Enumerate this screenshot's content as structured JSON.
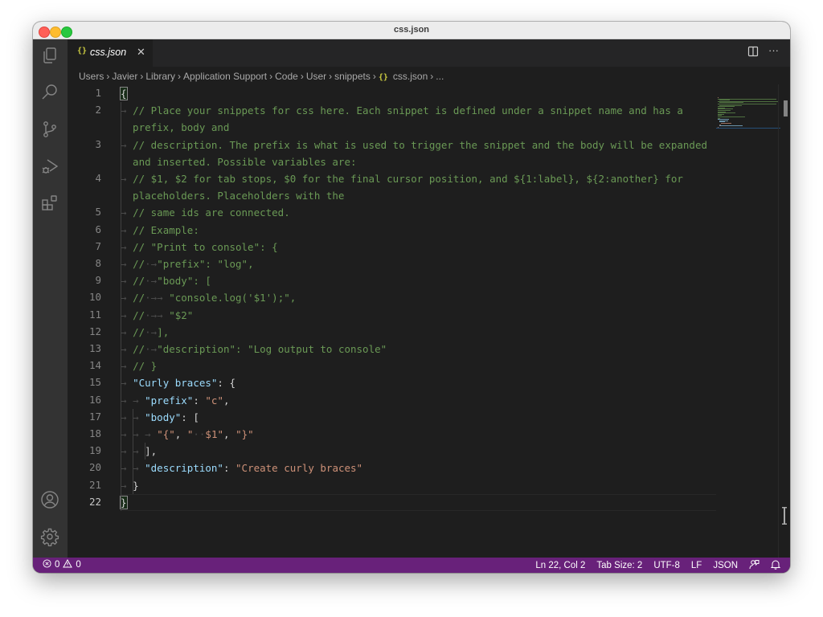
{
  "window": {
    "title": "css.json"
  },
  "activity_bar": [
    {
      "name": "explorer-icon"
    },
    {
      "name": "search-icon"
    },
    {
      "name": "source-control-icon"
    },
    {
      "name": "run-debug-icon"
    },
    {
      "name": "extensions-icon"
    }
  ],
  "activity_bar_bottom": [
    {
      "name": "accounts-icon"
    },
    {
      "name": "manage-gear-icon"
    }
  ],
  "tab": {
    "icon": "{}",
    "label": "css.json",
    "close": "✕"
  },
  "tab_actions": {
    "split": "split-editor-icon",
    "more": "···"
  },
  "breadcrumb": {
    "items": [
      "Users",
      "Javier",
      "Library",
      "Application Support",
      "Code",
      "User",
      "snippets"
    ],
    "file_icon": "{}",
    "file": "css.json",
    "trail": "..."
  },
  "editor": {
    "active_line": 22,
    "lines": [
      {
        "n": "1",
        "tokens": [
          {
            "t": "{",
            "c": "c-punc"
          }
        ]
      },
      {
        "n": "2",
        "tokens": [
          {
            "t": "// Place your snippets for css here. Each snippet is defined under a snippet name and has a",
            "c": "c-comment"
          }
        ],
        "wrap": "prefix, body and"
      },
      {
        "n": "3",
        "tokens": [
          {
            "t": "// description. The prefix is what is used to trigger the snippet and the body will be expanded",
            "c": "c-comment"
          }
        ],
        "wrap": "and inserted. Possible variables are:"
      },
      {
        "n": "4",
        "tokens": [
          {
            "t": "// $1, $2 for tab stops, $0 for the final cursor position, and ${1:label}, ${2:another} for",
            "c": "c-comment"
          }
        ],
        "wrap": "placeholders. Placeholders with the"
      },
      {
        "n": "5",
        "tokens": [
          {
            "t": "// same ids are connected.",
            "c": "c-comment"
          }
        ]
      },
      {
        "n": "6",
        "tokens": [
          {
            "t": "// Example:",
            "c": "c-comment"
          }
        ]
      },
      {
        "n": "7",
        "tokens": [
          {
            "t": "// \"Print to console\": {",
            "c": "c-comment"
          }
        ]
      },
      {
        "n": "8",
        "tokens": [
          {
            "t": "//",
            "c": "c-comment"
          },
          {
            "t": "·→",
            "c": "ws"
          },
          {
            "t": "\"prefix\": \"log\",",
            "c": "c-comment"
          }
        ]
      },
      {
        "n": "9",
        "tokens": [
          {
            "t": "//",
            "c": "c-comment"
          },
          {
            "t": "·→",
            "c": "ws"
          },
          {
            "t": "\"body\": [",
            "c": "c-comment"
          }
        ]
      },
      {
        "n": "10",
        "tokens": [
          {
            "t": "//",
            "c": "c-comment"
          },
          {
            "t": "·→→ ",
            "c": "ws"
          },
          {
            "t": "\"console.log('$1');\",",
            "c": "c-comment"
          }
        ]
      },
      {
        "n": "11",
        "tokens": [
          {
            "t": "//",
            "c": "c-comment"
          },
          {
            "t": "·→→ ",
            "c": "ws"
          },
          {
            "t": "\"$2\"",
            "c": "c-comment"
          }
        ]
      },
      {
        "n": "12",
        "tokens": [
          {
            "t": "//",
            "c": "c-comment"
          },
          {
            "t": "·→",
            "c": "ws"
          },
          {
            "t": "],",
            "c": "c-comment"
          }
        ]
      },
      {
        "n": "13",
        "tokens": [
          {
            "t": "//",
            "c": "c-comment"
          },
          {
            "t": "·→",
            "c": "ws"
          },
          {
            "t": "\"description\": \"Log output to console\"",
            "c": "c-comment"
          }
        ]
      },
      {
        "n": "14",
        "tokens": [
          {
            "t": "// }",
            "c": "c-comment"
          }
        ]
      },
      {
        "n": "15",
        "tokens": [
          {
            "t": "\"Curly braces\"",
            "c": "c-key"
          },
          {
            "t": ": {",
            "c": "c-punc"
          }
        ]
      },
      {
        "n": "16",
        "indent": 1,
        "tokens": [
          {
            "t": "\"prefix\"",
            "c": "c-key"
          },
          {
            "t": ": ",
            "c": "c-punc"
          },
          {
            "t": "\"c\"",
            "c": "c-str"
          },
          {
            "t": ",",
            "c": "c-punc"
          }
        ]
      },
      {
        "n": "17",
        "indent": 1,
        "tokens": [
          {
            "t": "\"body\"",
            "c": "c-key"
          },
          {
            "t": ": [",
            "c": "c-punc"
          }
        ]
      },
      {
        "n": "18",
        "indent": 2,
        "tokens": [
          {
            "t": "\"{\"",
            "c": "c-str"
          },
          {
            "t": ", ",
            "c": "c-punc"
          },
          {
            "t": "\"",
            "c": "c-str"
          },
          {
            "t": "··",
            "c": "ws"
          },
          {
            "t": "$1\"",
            "c": "c-str"
          },
          {
            "t": ", ",
            "c": "c-punc"
          },
          {
            "t": "\"}\"",
            "c": "c-str"
          }
        ]
      },
      {
        "n": "19",
        "indent": 1,
        "tokens": [
          {
            "t": "],",
            "c": "c-punc"
          }
        ]
      },
      {
        "n": "20",
        "indent": 1,
        "tokens": [
          {
            "t": "\"description\"",
            "c": "c-key"
          },
          {
            "t": ": ",
            "c": "c-punc"
          },
          {
            "t": "\"Create curly braces\"",
            "c": "c-str"
          }
        ]
      },
      {
        "n": "21",
        "tokens": [
          {
            "t": "}",
            "c": "c-punc"
          }
        ]
      },
      {
        "n": "22",
        "root": true,
        "tokens": [
          {
            "t": "}",
            "c": "c-punc"
          }
        ]
      }
    ]
  },
  "status_bar": {
    "errors": "0",
    "warnings": "0",
    "position": "Ln 22, Col 2",
    "tab_size": "Tab Size: 2",
    "encoding": "UTF-8",
    "eol": "LF",
    "language": "JSON"
  },
  "colors": {
    "status_bar": "#68217a",
    "comment": "#6a9955",
    "key": "#9cdcfe",
    "string": "#ce9178",
    "json_icon": "#cbcb41"
  }
}
